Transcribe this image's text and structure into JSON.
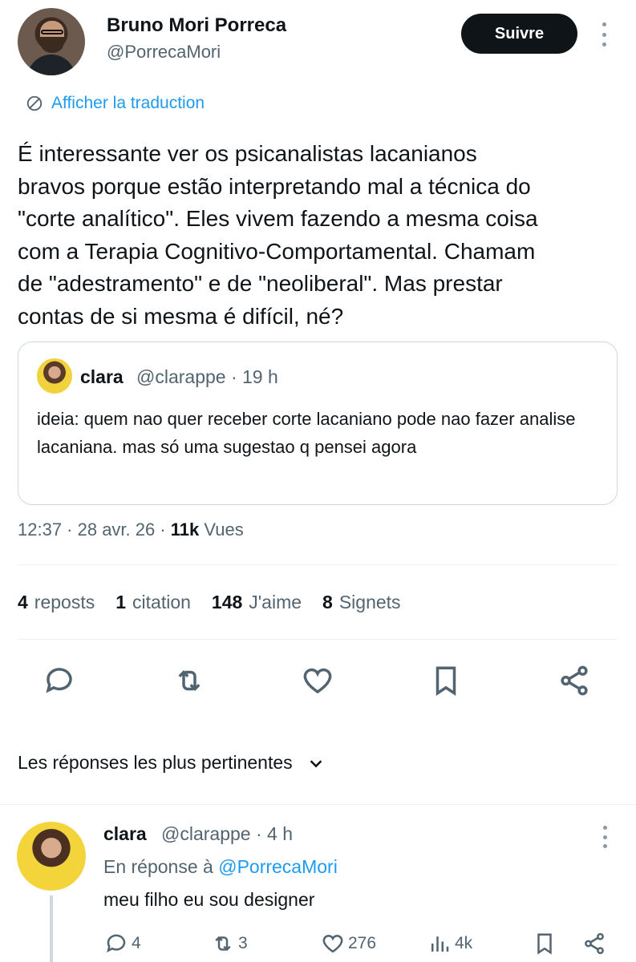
{
  "author": {
    "name": "Bruno Mori Porreca",
    "handle": "@PorrecaMori"
  },
  "follow_label": "Suivre",
  "translate_label": "Afficher la traduction",
  "tweet_text": "É interessante ver os psicanalistas lacanianos\nbravos porque estão interpretando mal a técnica do\n\"corte analítico\". Eles vivem fazendo a mesma coisa\ncom a Terapia Cognitivo-Comportamental. Chamam\nde \"adestramento\" e de \"neoliberal\". Mas prestar\ncontas de si mesma é difícil, né?",
  "quote": {
    "name": "clara",
    "meta": "@clarappe · 19 h",
    "text": "ideia: quem nao quer receber corte lacaniano pode nao fazer analise lacaniana. mas só uma sugestao q pensei agora"
  },
  "timestamp": {
    "prefix": "12:37 · 28 avr. 26 · ",
    "views_count": "11k",
    "views_label": "Vues"
  },
  "stats": [
    {
      "count": "4",
      "label": "reposts"
    },
    {
      "count": "1",
      "label": "citation"
    },
    {
      "count": "148",
      "label": "J'aime"
    },
    {
      "count": "8",
      "label": "Signets"
    }
  ],
  "sort_label": "Les réponses les plus pertinentes",
  "reply": {
    "name": "clara",
    "meta": "@clarappe · 4 h",
    "reply_to_prefix": "En réponse à",
    "reply_to_handle": "@PorrecaMori",
    "text": "meu filho eu sou designer",
    "counts": {
      "replies": "4",
      "reposts": "3",
      "likes": "276",
      "views": "4k"
    }
  },
  "colors": {
    "accent": "#1d9bf0",
    "text": "#0f1419",
    "muted": "#536471",
    "border": "#cfd9de"
  }
}
